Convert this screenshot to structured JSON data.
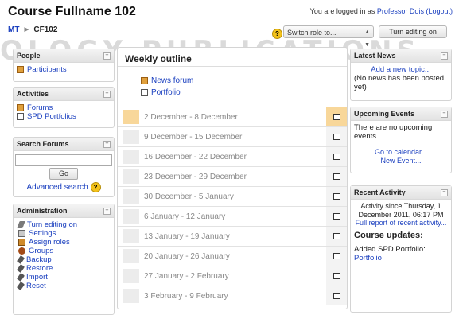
{
  "header": {
    "course_title": "Course Fullname 102",
    "login_prefix": "You are logged in as",
    "user_name": "Professor Dois",
    "logout_label": "(Logout)",
    "breadcrumb": [
      "MT",
      "CF102"
    ],
    "breadcrumb_sep": "►",
    "role_select_value": "Switch role to...",
    "turn_editing_label": "Turn editing on",
    "watermark_text": "OLOGY PUBLICATIONS"
  },
  "left": {
    "people": {
      "title": "People",
      "items": [
        "Participants"
      ]
    },
    "activities": {
      "title": "Activities",
      "items": [
        "Forums",
        "SPD Portfolios"
      ]
    },
    "search": {
      "title": "Search Forums",
      "go_label": "Go",
      "advanced_label": "Advanced search"
    },
    "admin": {
      "title": "Administration",
      "items": [
        "Turn editing on",
        "Settings",
        "Assign roles",
        "Groups",
        "Backup",
        "Restore",
        "Import",
        "Reset"
      ],
      "icons": [
        "edit-icon",
        "settings-icon",
        "assign-roles-icon",
        "groups-icon",
        "backup-icon",
        "restore-icon",
        "import-icon",
        "reset-icon"
      ]
    }
  },
  "main": {
    "title": "Weekly outline",
    "section0_items": [
      "News forum",
      "Portfolio"
    ],
    "weeks": [
      "2 December - 8 December",
      "9 December - 15 December",
      "16 December - 22 December",
      "23 December - 29 December",
      "30 December - 5 January",
      "6 January - 12 January",
      "13 January - 19 January",
      "20 January - 26 January",
      "27 January - 2 February",
      "3 February - 9 February"
    ]
  },
  "right": {
    "news": {
      "title": "Latest News",
      "add_topic": "Add a new topic...",
      "empty": "(No news has been posted yet)"
    },
    "events": {
      "title": "Upcoming Events",
      "empty": "There are no upcoming events",
      "calendar_link": "Go to calendar...",
      "new_event_link": "New Event..."
    },
    "recent": {
      "title": "Recent Activity",
      "since": "Activity since Thursday, 1 December 2011, 06:17 PM",
      "full_report": "Full report of recent activity...",
      "updates_heading": "Course updates:",
      "update_text": "Added SPD Portfolio:",
      "update_link": "Portfolio"
    }
  },
  "colors": {
    "current_week": "#f8d79a",
    "link": "#1a3fbf",
    "help_icon": "#f3c21b"
  }
}
